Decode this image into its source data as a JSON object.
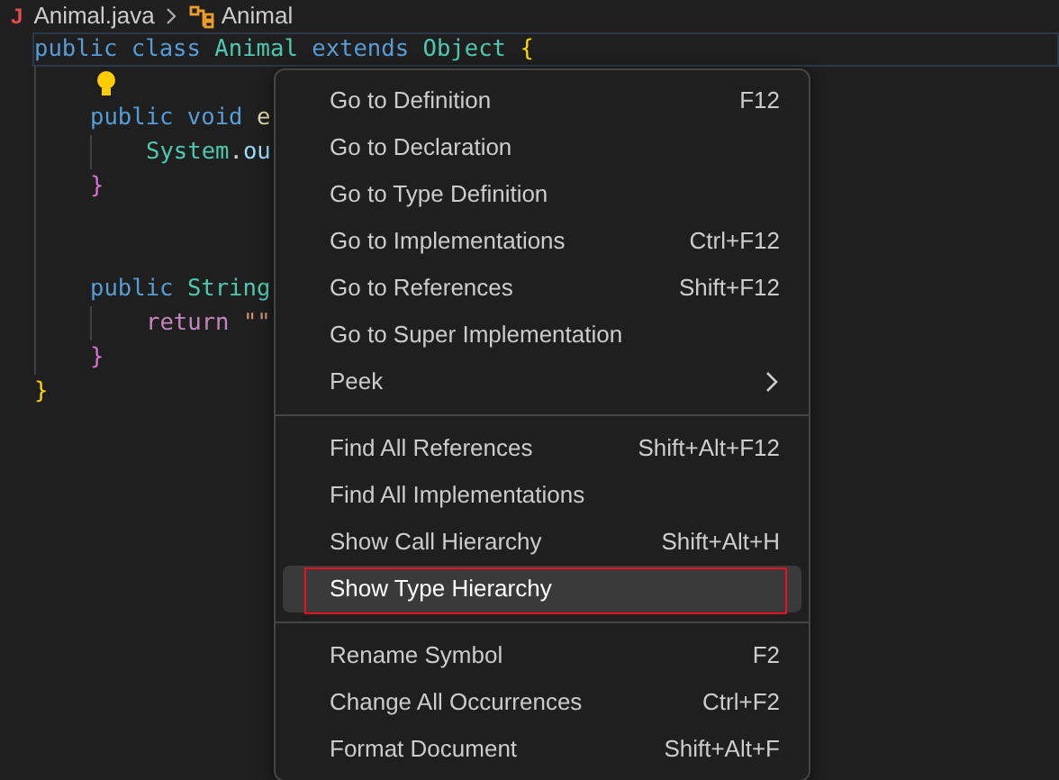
{
  "breadcrumb": {
    "file_icon": "J",
    "file": "Animal.java",
    "symbol": "Animal"
  },
  "code": [
    {
      "kind": "code",
      "current": true,
      "tokens": [
        {
          "text": "public class ",
          "color": "#569cd6"
        },
        {
          "text": "Animal ",
          "color": "#4ec9b0"
        },
        {
          "text": "extends ",
          "color": "#569cd6"
        },
        {
          "text": "Object ",
          "color": "#4ec9b0"
        },
        {
          "text": "{",
          "color": "#ffd700"
        }
      ],
      "children": [
        {
          "kind": "lightbulb",
          "current": false
        },
        {
          "kind": "code",
          "current": false,
          "tokens": [
            {
              "text": "public void ",
              "color": "#569cd6"
            },
            {
              "text": "e",
              "color": "#dcdcaa"
            }
          ],
          "children": [
            {
              "kind": "code",
              "current": false,
              "tokens": [
                {
                  "text": "System",
                  "color": "#4ec9b0"
                },
                {
                  "text": ".",
                  "color": "#d4d4d4"
                },
                {
                  "text": "ou",
                  "color": "#9cdcfe"
                }
              ]
            }
          ]
        },
        {
          "kind": "code",
          "current": false,
          "tokens": [
            {
              "text": "}",
              "color": "#da70d6"
            }
          ]
        },
        {
          "kind": "blank",
          "current": false
        },
        {
          "kind": "blank",
          "current": false
        },
        {
          "kind": "code",
          "current": false,
          "tokens": [
            {
              "text": "public ",
              "color": "#569cd6"
            },
            {
              "text": "String",
              "color": "#4ec9b0"
            }
          ],
          "children": [
            {
              "kind": "code",
              "current": false,
              "tokens": [
                {
                  "text": "return ",
                  "color": "#c586c0"
                },
                {
                  "text": "\"\"",
                  "color": "#ce9178"
                }
              ]
            }
          ]
        },
        {
          "kind": "code",
          "current": false,
          "tokens": [
            {
              "text": "}",
              "color": "#da70d6"
            }
          ]
        }
      ]
    },
    {
      "kind": "code",
      "current": false,
      "tokens": [
        {
          "text": "}",
          "color": "#ffd700"
        }
      ]
    }
  ],
  "context_menu": [
    {
      "kind": "item",
      "label": "Go to Definition",
      "shortcut": "F12",
      "selected": false
    },
    {
      "kind": "item",
      "label": "Go to Declaration",
      "selected": false
    },
    {
      "kind": "item",
      "label": "Go to Type Definition",
      "selected": false
    },
    {
      "kind": "item",
      "label": "Go to Implementations",
      "shortcut": "Ctrl+F12",
      "selected": false
    },
    {
      "kind": "item",
      "label": "Go to References",
      "shortcut": "Shift+F12",
      "selected": false
    },
    {
      "kind": "item",
      "label": "Go to Super Implementation",
      "selected": false
    },
    {
      "kind": "submenu",
      "label": "Peek",
      "selected": false
    },
    {
      "kind": "separator"
    },
    {
      "kind": "item",
      "label": "Find All References",
      "shortcut": "Shift+Alt+F12",
      "selected": false
    },
    {
      "kind": "item",
      "label": "Find All Implementations",
      "selected": false
    },
    {
      "kind": "item",
      "label": "Show Call Hierarchy",
      "shortcut": "Shift+Alt+H",
      "selected": false
    },
    {
      "kind": "item",
      "label": "Show Type Hierarchy",
      "selected": true,
      "annotated": true
    },
    {
      "kind": "separator"
    },
    {
      "kind": "item",
      "label": "Rename Symbol",
      "shortcut": "F2",
      "selected": false
    },
    {
      "kind": "item",
      "label": "Change All Occurrences",
      "shortcut": "Ctrl+F2",
      "selected": false
    },
    {
      "kind": "item",
      "label": "Format Document",
      "shortcut": "Shift+Alt+F",
      "selected": false
    }
  ]
}
